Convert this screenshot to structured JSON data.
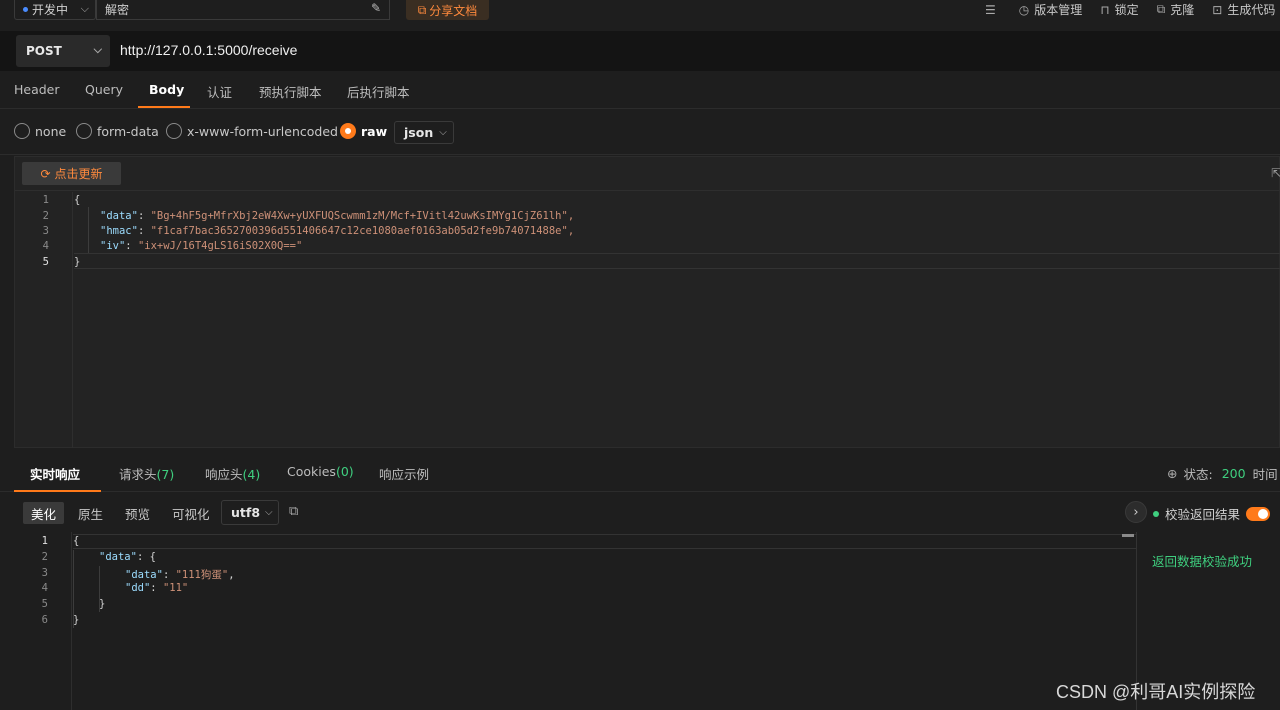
{
  "topbar": {
    "environment": "开发中",
    "request_name": "解密",
    "share_label": "分享文档",
    "actions": [
      {
        "icon": "history-icon",
        "label": "版本管理"
      },
      {
        "icon": "lock-icon",
        "label": "锁定"
      },
      {
        "icon": "clone-icon",
        "label": "克隆"
      },
      {
        "icon": "code-icon",
        "label": "生成代码"
      }
    ]
  },
  "request": {
    "method": "POST",
    "url": "http://127.0.0.1:5000/receive"
  },
  "request_tabs": [
    "Header",
    "Query",
    "Body",
    "认证",
    "预执行脚本",
    "后执行脚本"
  ],
  "request_active_tab": "Body",
  "body_types": {
    "options": [
      "none",
      "form-data",
      "x-www-form-urlencoded",
      "raw"
    ],
    "selected": "raw",
    "format": "json"
  },
  "request_body": {
    "update_label": "点击更新",
    "line_numbers": [
      "1",
      "2",
      "3",
      "4",
      "5"
    ],
    "lines": [
      {
        "text": "{"
      },
      {
        "key": "\"data\"",
        "value": "\"Bg+4hF5g+MfrXbj2eW4Xw+yUXFUQScwmm1zM/Mcf+IVitl42uwKsIMYg1CjZ61lh\","
      },
      {
        "key": "\"hmac\"",
        "value": "\"f1caf7bac3652700396d551406647c12ce1080aef0163ab05d2fe9b74071488e\","
      },
      {
        "key": "\"iv\"",
        "value": "\"ix+wJ/16T4gLS16iS02X0Q==\""
      },
      {
        "text": "}"
      }
    ]
  },
  "response_tabs": [
    {
      "label": "实时响应",
      "count": ""
    },
    {
      "label": "请求头",
      "count": "(7)"
    },
    {
      "label": "响应头",
      "count": "(4)"
    },
    {
      "label": "Cookies",
      "count": "(0)"
    },
    {
      "label": "响应示例",
      "count": ""
    }
  ],
  "response_active_tab": "实时响应",
  "status": {
    "label": "状态:",
    "code": "200",
    "time_label": "时间"
  },
  "view_modes": [
    "美化",
    "原生",
    "预览",
    "可视化"
  ],
  "view_active": "美化",
  "encoding": "utf8",
  "response_body": {
    "line_numbers": [
      "1",
      "2",
      "3",
      "4",
      "5",
      "6"
    ],
    "l1": "{",
    "l2_key": "\"data\"",
    "l2_rest": ": {",
    "l3_key": "\"data\"",
    "l3_value": "\"111狗蛋\"",
    "l4_key": "\"dd\"",
    "l4_value": "\"11\"",
    "l5": "}",
    "l6": "}"
  },
  "verify": {
    "label": "校验返回结果",
    "enabled": true,
    "message": "返回数据校验成功"
  },
  "watermark": "CSDN @利哥AI实例探险",
  "colors": {
    "accent": "#ff7a1a",
    "success": "#3fcf7f",
    "key": "#9cdcfe",
    "string": "#ce9178"
  }
}
